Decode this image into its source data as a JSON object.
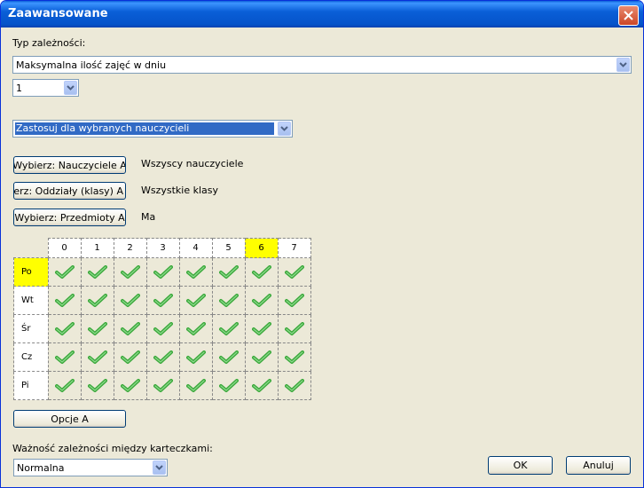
{
  "window": {
    "title": "Zaawansowane",
    "close_icon": "close-icon"
  },
  "dependency_type": {
    "label": "Typ zależności:",
    "value": "Maksymalna ilość zajęć w dniu",
    "count_value": "1"
  },
  "apply_scope": {
    "value": "Zastosuj dla wybranych nauczycieli"
  },
  "selectors": [
    {
      "button": "Wybierz: Nauczyciele A",
      "value": "Wszyscy nauczyciele"
    },
    {
      "button": "Wybierz: Oddziały (klasy) A",
      "value": "Wszystkie klasy"
    },
    {
      "button": "Wybierz: Przedmioty A",
      "value": "Ma"
    }
  ],
  "grid": {
    "columns": [
      "0",
      "1",
      "2",
      "3",
      "4",
      "5",
      "6",
      "7"
    ],
    "rows": [
      "Po",
      "Wt",
      "Śr",
      "Cz",
      "Pi"
    ],
    "highlighted_column": "6",
    "highlighted_row": "Po",
    "cell_icon": "checkmark-icon",
    "highlight_color": "#ffff00",
    "check_color": "#3aa83a"
  },
  "options_button": "Opcje A",
  "importance": {
    "label": "Ważność zależności między karteczkami:",
    "value": "Normalna"
  },
  "footer": {
    "ok": "OK",
    "cancel": "Anuluj"
  }
}
